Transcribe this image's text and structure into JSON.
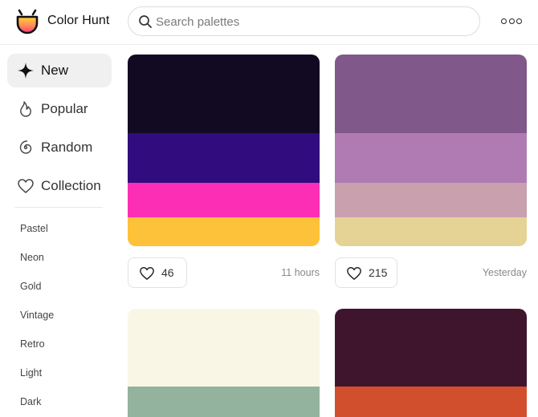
{
  "header": {
    "brand": "Color Hunt",
    "search_placeholder": "Search palettes"
  },
  "sidebar": {
    "nav": [
      {
        "label": "New",
        "icon": "sparkle-icon",
        "active": true
      },
      {
        "label": "Popular",
        "icon": "flame-icon",
        "active": false
      },
      {
        "label": "Random",
        "icon": "spiral-icon",
        "active": false
      },
      {
        "label": "Collection",
        "icon": "heart-icon",
        "active": false
      }
    ],
    "tags": [
      "Pastel",
      "Neon",
      "Gold",
      "Vintage",
      "Retro",
      "Light",
      "Dark"
    ]
  },
  "palettes": [
    {
      "colors": [
        "#120A22",
        "#300C7E",
        "#FB2EB5",
        "#FEC13A"
      ],
      "likes": "46",
      "time": "11 hours"
    },
    {
      "colors": [
        "#81588A",
        "#B07BB3",
        "#C9A0AE",
        "#E5D395"
      ],
      "likes": "215",
      "time": "Yesterday"
    },
    {
      "colors": [
        "#FAF6E5",
        "#93B39E"
      ],
      "likes": "",
      "time": ""
    },
    {
      "colors": [
        "#3F152E",
        "#D24F2E"
      ],
      "likes": "",
      "time": ""
    }
  ]
}
